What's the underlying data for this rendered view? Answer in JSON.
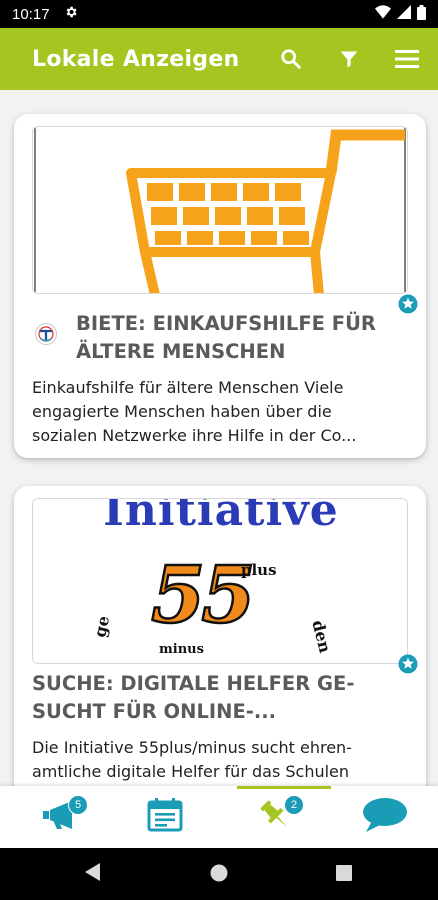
{
  "status": {
    "time": "10:17"
  },
  "app_bar": {
    "title": "Lokale Anzeigen"
  },
  "cards": [
    {
      "title": "BIETE: EINKAUFSHILFE FÜR ÄLTERE MENSCHEN",
      "title_lines": [
        "BIETE: EINKAUFSHILFE FÜR",
        "ÄLTERE MENSCHEN"
      ],
      "description_lines": [
        "Einkaufshilfe für ältere Menschen Viele",
        "engagierte Menschen haben über die",
        "sozialen Netzwerke ihre Hilfe in der Co..."
      ]
    },
    {
      "title": "SUCHE: DIGITALE HELFER GESUCHT FÜR ONLINE-...",
      "title_lines": [
        "SUCHE: DIGITALE HELFER GE-",
        "SUCHT FÜR ONLINE-..."
      ],
      "description_lines": [
        "Die Initiative 55plus/minus sucht ehren-",
        "amtliche digitale Helfer für das Schulen"
      ],
      "image_texts": {
        "heading": "Initiative",
        "number": "55",
        "plus": "plus",
        "minus": "minus",
        "arc_left": "ge",
        "arc_right": "den"
      }
    }
  ],
  "bottom_nav": {
    "items": [
      {
        "icon": "megaphone-icon",
        "badge": "5"
      },
      {
        "icon": "calendar-icon"
      },
      {
        "icon": "pin-icon",
        "badge": "2"
      },
      {
        "icon": "chat-icon"
      }
    ]
  },
  "colors": {
    "primary": "#a5c520",
    "accent": "#1b9cb6",
    "cart": "#f7a21b"
  }
}
